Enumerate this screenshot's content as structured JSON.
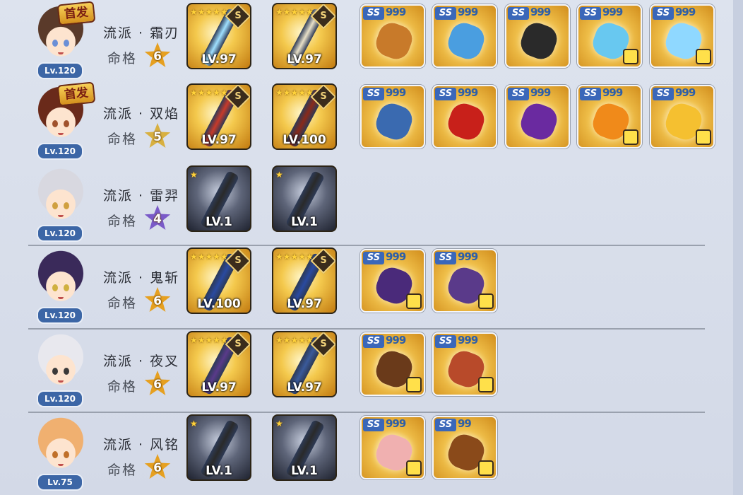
{
  "characters": [
    {
      "level": "Lv.120",
      "first": "首发",
      "school": "流派 · 霜刃",
      "fate_label": "命格",
      "fate": "6",
      "hair": "#5a3a2a",
      "eye": "#6b8fd6",
      "star": "#e6a020",
      "weapons": [
        {
          "stars": 5,
          "grade": "S",
          "level": "LV.97",
          "style": "gold",
          "blade_color": "#9fe0ff"
        },
        {
          "stars": 5,
          "grade": "S",
          "level": "LV.97",
          "style": "gold",
          "blade_color": "#e8e0c8"
        }
      ],
      "treasures": [
        {
          "badge": "SS",
          "quality": "999",
          "art": "#c87a2a",
          "shirt": false
        },
        {
          "badge": "SS",
          "quality": "999",
          "art": "#4a9ee0",
          "shirt": false
        },
        {
          "badge": "SS",
          "quality": "999",
          "art": "#2a2a2a",
          "shirt": false
        },
        {
          "badge": "SS",
          "quality": "999",
          "art": "#68c8f0",
          "shirt": true
        },
        {
          "badge": "SS",
          "quality": "999",
          "art": "#8fd8ff",
          "shirt": true
        }
      ]
    },
    {
      "level": "Lv.120",
      "first": "首发",
      "school": "流派 · 双焰",
      "fate_label": "命格",
      "fate": "5",
      "hair": "#6a2a1a",
      "eye": "#a0522d",
      "star": "#d8b040",
      "weapons": [
        {
          "stars": 5,
          "grade": "S",
          "level": "LV.97",
          "style": "gold",
          "blade_color": "#c83a2a"
        },
        {
          "stars": 5,
          "grade": "S",
          "level": "LV.100",
          "style": "gold",
          "blade_color": "#8a2a1a"
        }
      ],
      "treasures": [
        {
          "badge": "SS",
          "quality": "999",
          "art": "#3a6ab0",
          "shirt": false
        },
        {
          "badge": "SS",
          "quality": "999",
          "art": "#c8201a",
          "shirt": false
        },
        {
          "badge": "SS",
          "quality": "999",
          "art": "#6a2aa0",
          "shirt": false
        },
        {
          "badge": "SS",
          "quality": "999",
          "art": "#f08a1a",
          "shirt": true
        },
        {
          "badge": "SS",
          "quality": "999",
          "art": "#f5c030",
          "shirt": true
        }
      ]
    },
    {
      "level": "Lv.120",
      "first": "",
      "school": "流派 · 雷羿",
      "fate_label": "命格",
      "fate": "4",
      "hair": "#d8d8e0",
      "eye": "#d0a040",
      "star": "#7a5ac8",
      "weapons": [
        {
          "stars": 1,
          "grade": "",
          "level": "LV.1",
          "style": "dark",
          "blade_color": "#2a2a2a"
        },
        {
          "stars": 1,
          "grade": "",
          "level": "LV.1",
          "style": "dark",
          "blade_color": "#2a2a2a"
        }
      ],
      "treasures": []
    },
    {
      "level": "Lv.120",
      "first": "",
      "school": "流派 · 鬼斩",
      "fate_label": "命格",
      "fate": "6",
      "hair": "#3a2a5a",
      "eye": "#d0b040",
      "star": "#e6a020",
      "weapons": [
        {
          "stars": 5,
          "grade": "S",
          "level": "LV.100",
          "style": "gold",
          "blade_color": "#2a4aa0"
        },
        {
          "stars": 5,
          "grade": "S",
          "level": "LV.97",
          "style": "gold",
          "blade_color": "#2a4aa0"
        }
      ],
      "treasures": [
        {
          "badge": "SS",
          "quality": "999",
          "art": "#4a2a7a",
          "shirt": true
        },
        {
          "badge": "SS",
          "quality": "999",
          "art": "#5a3a8a",
          "shirt": true
        }
      ]
    },
    {
      "level": "Lv.120",
      "first": "",
      "school": "流派 · 夜叉",
      "fate_label": "命格",
      "fate": "6",
      "hair": "#e8e8ee",
      "eye": "#3a3a3a",
      "star": "#e6a020",
      "weapons": [
        {
          "stars": 5,
          "grade": "S",
          "level": "LV.97",
          "style": "gold",
          "blade_color": "#5a3a8a"
        },
        {
          "stars": 5,
          "grade": "S",
          "level": "LV.97",
          "style": "gold",
          "blade_color": "#3a5a9a"
        }
      ],
      "treasures": [
        {
          "badge": "SS",
          "quality": "999",
          "art": "#6a3a1a",
          "shirt": true
        },
        {
          "badge": "SS",
          "quality": "999",
          "art": "#b84a2a",
          "shirt": true
        }
      ]
    },
    {
      "level": "Lv.75",
      "first": "",
      "school": "流派 · 风铭",
      "fate_label": "命格",
      "fate": "6",
      "hair": "#f0b070",
      "eye": "#c0702a",
      "star": "#e6a020",
      "weapons": [
        {
          "stars": 1,
          "grade": "",
          "level": "LV.1",
          "style": "dark",
          "blade_color": "#2a2a2a"
        },
        {
          "stars": 1,
          "grade": "",
          "level": "LV.1",
          "style": "dark",
          "blade_color": "#2a2a2a"
        }
      ],
      "treasures": [
        {
          "badge": "SS",
          "quality": "999",
          "art": "#f0b0b0",
          "shirt": true
        },
        {
          "badge": "SS",
          "quality": "99",
          "art": "#8a4a1a",
          "shirt": true
        }
      ]
    }
  ]
}
